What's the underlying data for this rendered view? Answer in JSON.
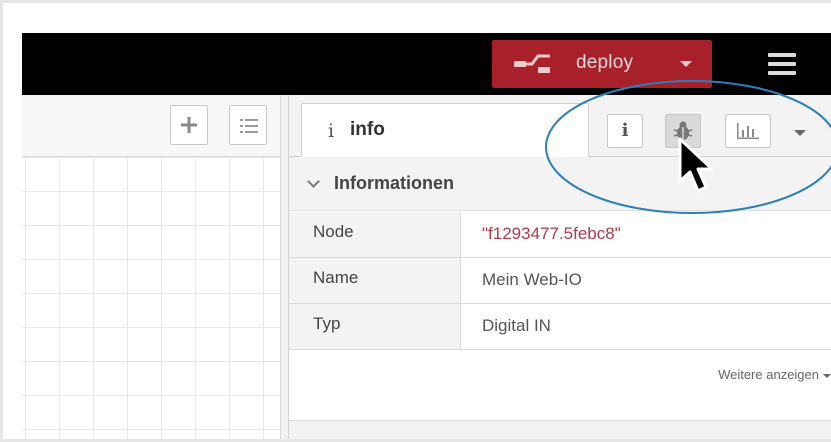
{
  "header": {
    "deploy_label": "deploy",
    "background": "#000000",
    "deploy_color": "#a7202a"
  },
  "workspace": {
    "add_icon": "plus-icon",
    "list_icon": "list-icon"
  },
  "sidebar": {
    "active_tab": {
      "icon": "i",
      "label": "info"
    },
    "tab_buttons": [
      "info-icon",
      "bug-icon",
      "chart-icon"
    ],
    "section_title": "Informationen",
    "properties": [
      {
        "key": "Node",
        "value": "\"f1293477.5febc8\""
      },
      {
        "key": "Name",
        "value": "Mein Web-IO"
      },
      {
        "key": "Typ",
        "value": "Digital IN"
      }
    ],
    "show_more": "Weitere anzeigen"
  },
  "annotation": {
    "ellipse_color": "#2a7fba"
  }
}
